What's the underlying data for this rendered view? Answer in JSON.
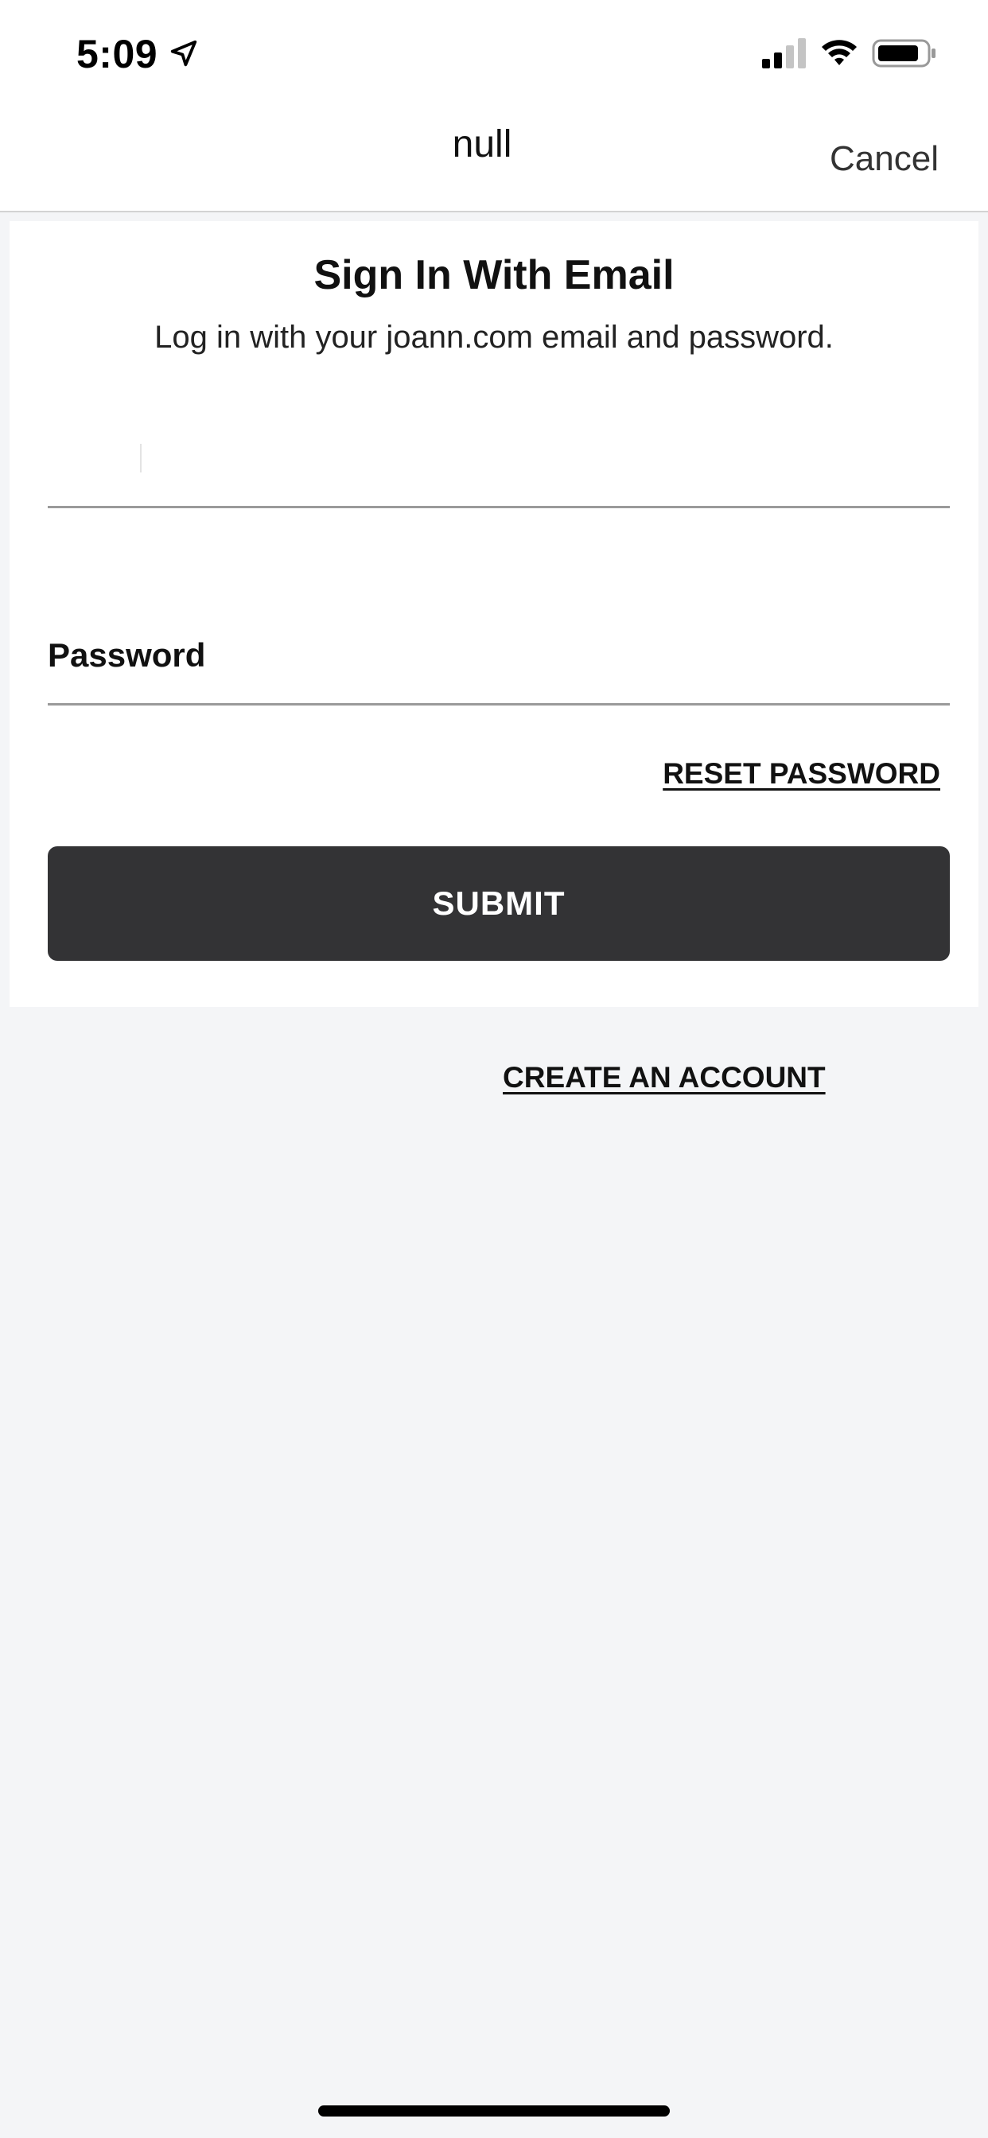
{
  "status_bar": {
    "time": "5:09",
    "icons": [
      "location-arrow-icon",
      "cellular-signal-icon",
      "wifi-icon",
      "battery-icon"
    ]
  },
  "nav": {
    "title": "null",
    "cancel_label": "Cancel"
  },
  "signin": {
    "title": "Sign In With Email",
    "subtitle": "Log in with your joann.com email and password.",
    "email": {
      "value": "",
      "placeholder": ""
    },
    "password_label": "Password",
    "reset_label": "RESET PASSWORD",
    "submit_label": "SUBMIT"
  },
  "footer": {
    "create_account_label": "CREATE AN ACCOUNT"
  },
  "colors": {
    "background": "#f4f5f7",
    "card": "#ffffff",
    "button": "#333335",
    "button_text": "#ffffff",
    "text": "#111111"
  }
}
